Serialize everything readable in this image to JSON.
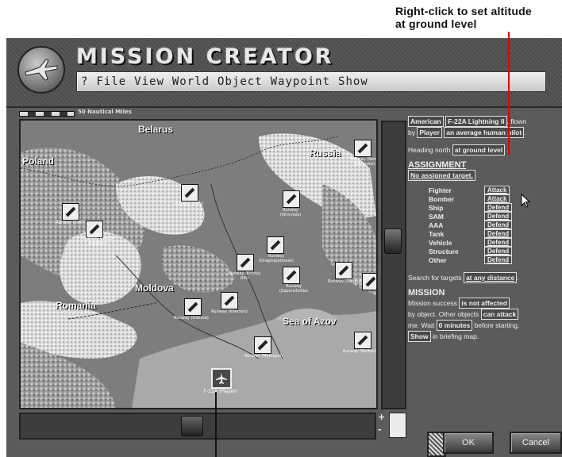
{
  "annotation": {
    "line1": "Right-click to set altitude",
    "line2": "at ground level"
  },
  "app": {
    "title": "MISSION CREATOR",
    "menu": [
      "?",
      "File",
      "View",
      "World",
      "Object",
      "Waypoint",
      "Show"
    ]
  },
  "map": {
    "scale_label": "50 Nautical Miles",
    "place_labels": [
      "Belarus",
      "Russia",
      "Poland",
      "Moldova",
      "Romania",
      "Sea of Azov"
    ],
    "markers": [
      {
        "label": "Runway (Nova Kakhovka)"
      },
      {
        "label": "Runway (Kiev)"
      },
      {
        "label": "Runway (Vinnytsia)"
      },
      {
        "label": "Runway (Lviv)"
      },
      {
        "label": "Runway (Ivano-Frankivsk)"
      },
      {
        "label": "Runway (Dnepropetrovsk)"
      },
      {
        "label": "Runway (Kryvyy Rih)"
      },
      {
        "label": "Runway (Zaporizhzhia)"
      },
      {
        "label": "Runway (Donetsk)"
      },
      {
        "label": "Runway (Odessa)"
      },
      {
        "label": "Runway (Kherson)"
      },
      {
        "label": "Runway (Melitopol)"
      },
      {
        "label": "Runway (Rostov)"
      },
      {
        "label": "Runway (Belbek)"
      },
      {
        "label": "Runway (Lugansk)"
      }
    ],
    "player_unit_label": "F-22A (Player)"
  },
  "panel": {
    "country": "American",
    "aircraft": "F-22A Lightning II",
    "flown_text": ", flown",
    "by_text": "by",
    "pilot_by": "Player",
    "pilot_skill": "an average human pilot",
    "heading_text": "Heading north",
    "altitude_prefix": "at",
    "altitude": "ground level",
    "assignment_title": "ASSIGNMENT",
    "target_value": "No assigned target.",
    "rows": [
      {
        "name": "Fighter",
        "value": "Attack"
      },
      {
        "name": "Bomber",
        "value": "Attack"
      },
      {
        "name": "Ship",
        "value": "Defend"
      },
      {
        "name": "SAM",
        "value": "Defend"
      },
      {
        "name": "AAA",
        "value": "Defend"
      },
      {
        "name": "Tank",
        "value": "Defend"
      },
      {
        "name": "Vehicle",
        "value": "Defend"
      },
      {
        "name": "Structure",
        "value": "Defend"
      },
      {
        "name": "Other",
        "value": "Defend"
      }
    ],
    "search_text": "Search for targets",
    "search_value": "at any distance",
    "mission_title": "MISSION",
    "mission_text1": "Mission success",
    "mission_value1": "is not affected",
    "mission_text2": "by object. Other objects",
    "mission_value2": "can attack",
    "mission_text3": "me. Wait",
    "mission_value3": "0 minutes",
    "mission_text4": "before starting.",
    "mission_value4": "Show",
    "mission_text5": "in briefing map."
  },
  "buttons": {
    "ok": "OK",
    "cancel": "Cancel"
  },
  "zoom": {
    "plus": "+",
    "minus": "-"
  }
}
